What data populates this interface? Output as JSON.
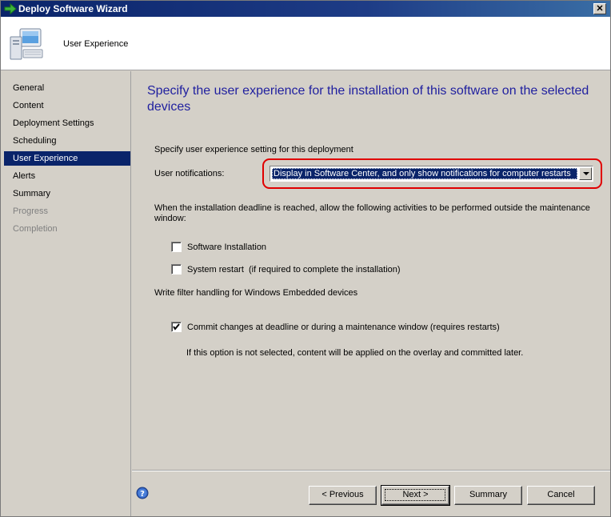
{
  "window": {
    "title": "Deploy Software Wizard",
    "close_label": "✕"
  },
  "header": {
    "title": "User Experience",
    "icon": "computer-icon"
  },
  "nav": {
    "items": [
      {
        "label": "General",
        "state": "normal"
      },
      {
        "label": "Content",
        "state": "normal"
      },
      {
        "label": "Deployment Settings",
        "state": "normal"
      },
      {
        "label": "Scheduling",
        "state": "normal"
      },
      {
        "label": "User Experience",
        "state": "selected"
      },
      {
        "label": "Alerts",
        "state": "normal"
      },
      {
        "label": "Summary",
        "state": "normal"
      },
      {
        "label": "Progress",
        "state": "disabled"
      },
      {
        "label": "Completion",
        "state": "disabled"
      }
    ]
  },
  "main": {
    "title": "Specify the user experience for the installation of this software on the selected devices",
    "section_label": "Specify user experience setting for this deployment",
    "notifications_label": "User notifications:",
    "notifications_value": "Display in Software Center, and only show notifications for computer restarts",
    "deadline_text": "When the installation deadline is reached, allow the following activities to be performed outside the maintenance window:",
    "software_installation": {
      "label": "Software Installation",
      "checked": false
    },
    "system_restart": {
      "label": "System restart  (if required to complete the installation)",
      "checked": false
    },
    "write_filter_label": "Write filter handling for Windows Embedded devices",
    "commit_changes": {
      "label": "Commit changes at deadline or during a maintenance window (requires restarts)",
      "checked": true
    },
    "commit_note": "If this option is not selected, content will be applied on the overlay and committed later."
  },
  "footer": {
    "help_icon": "help-icon",
    "previous_label": "< Previous",
    "next_label": "Next >",
    "summary_label": "Summary",
    "cancel_label": "Cancel"
  },
  "colors": {
    "title_bar": "#0a246a",
    "heading": "#1f1f9f",
    "selection": "#0a246a",
    "highlight_ring": "#e00000"
  }
}
